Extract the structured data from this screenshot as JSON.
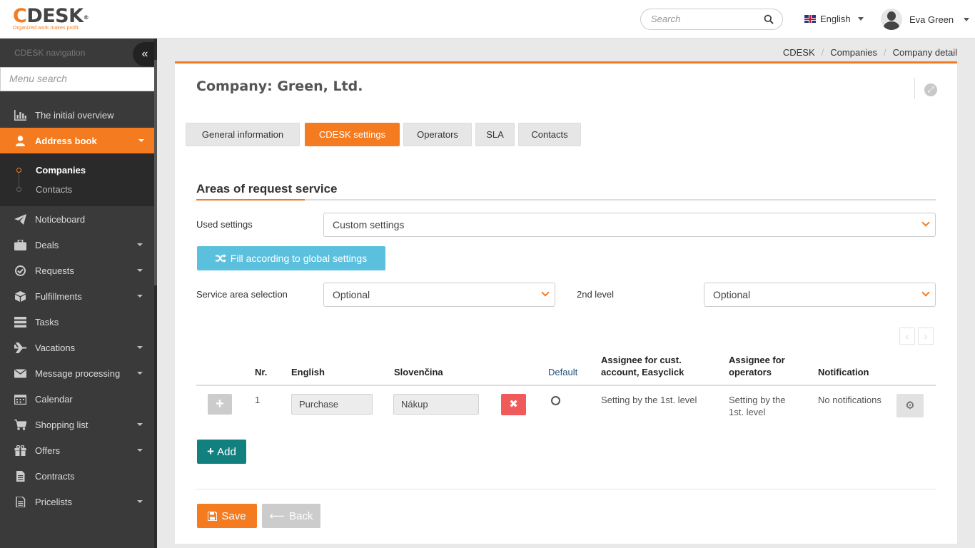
{
  "header": {
    "logo_text": "CDESK",
    "logo_tagline": "Organized work makes profit",
    "search_placeholder": "Search",
    "language": "English",
    "user_name": "Eva Green"
  },
  "sidebar": {
    "nav_title": "CDESK navigation",
    "menu_search_placeholder": "Menu search",
    "items": [
      {
        "label": "The initial overview",
        "icon": "chart-icon"
      },
      {
        "label": "Address book",
        "icon": "user-icon"
      },
      {
        "label": "Noticeboard",
        "icon": "paper-plane-icon"
      },
      {
        "label": "Deals",
        "icon": "briefcase-icon"
      },
      {
        "label": "Requests",
        "icon": "check-circle-icon"
      },
      {
        "label": "Fulfillments",
        "icon": "cube-icon"
      },
      {
        "label": "Tasks",
        "icon": "tasks-icon"
      },
      {
        "label": "Vacations",
        "icon": "plane-icon"
      },
      {
        "label": "Message processing",
        "icon": "envelope-icon"
      },
      {
        "label": "Calendar",
        "icon": "calendar-icon"
      },
      {
        "label": "Shopping list",
        "icon": "cart-icon"
      },
      {
        "label": "Offers",
        "icon": "gift-icon"
      },
      {
        "label": "Contracts",
        "icon": "document-icon"
      },
      {
        "label": "Pricelists",
        "icon": "document-text-icon"
      }
    ],
    "sub_items": [
      {
        "label": "Companies"
      },
      {
        "label": "Contacts"
      }
    ]
  },
  "breadcrumb": [
    "CDESK",
    "Companies",
    "Company detail"
  ],
  "page": {
    "title": "Company: Green, Ltd.",
    "tabs": [
      "General information",
      "CDESK settings",
      "Operators",
      "SLA",
      "Contacts"
    ],
    "section_title": "Areas of request service",
    "used_settings_label": "Used settings",
    "used_settings_value": "Custom settings",
    "fill_button": "Fill according to global settings",
    "service_area_label": "Service area selection",
    "service_area_value": "Optional",
    "second_level_label": "2nd level",
    "second_level_value": "Optional"
  },
  "table": {
    "headers": {
      "nr": "Nr.",
      "english": "English",
      "slovencina": "Slovenčina",
      "default": "Default",
      "assignee_cust": "Assignee for cust. account, Easyclick",
      "assignee_ops": "Assignee for operators",
      "notification": "Notification"
    },
    "rows": [
      {
        "nr": "1",
        "english": "Purchase",
        "slovencina": "Nákup",
        "assignee_cust": "Setting by the 1st. level",
        "assignee_ops": "Setting by the 1st. level",
        "notification": "No notifications"
      }
    ]
  },
  "actions": {
    "add": "Add",
    "save": "Save",
    "back": "Back"
  },
  "colors": {
    "accent": "#f47b20",
    "info": "#5bc0de",
    "teal": "#138080",
    "danger": "#ef5b5b",
    "sidebar": "#3a3a3a"
  }
}
